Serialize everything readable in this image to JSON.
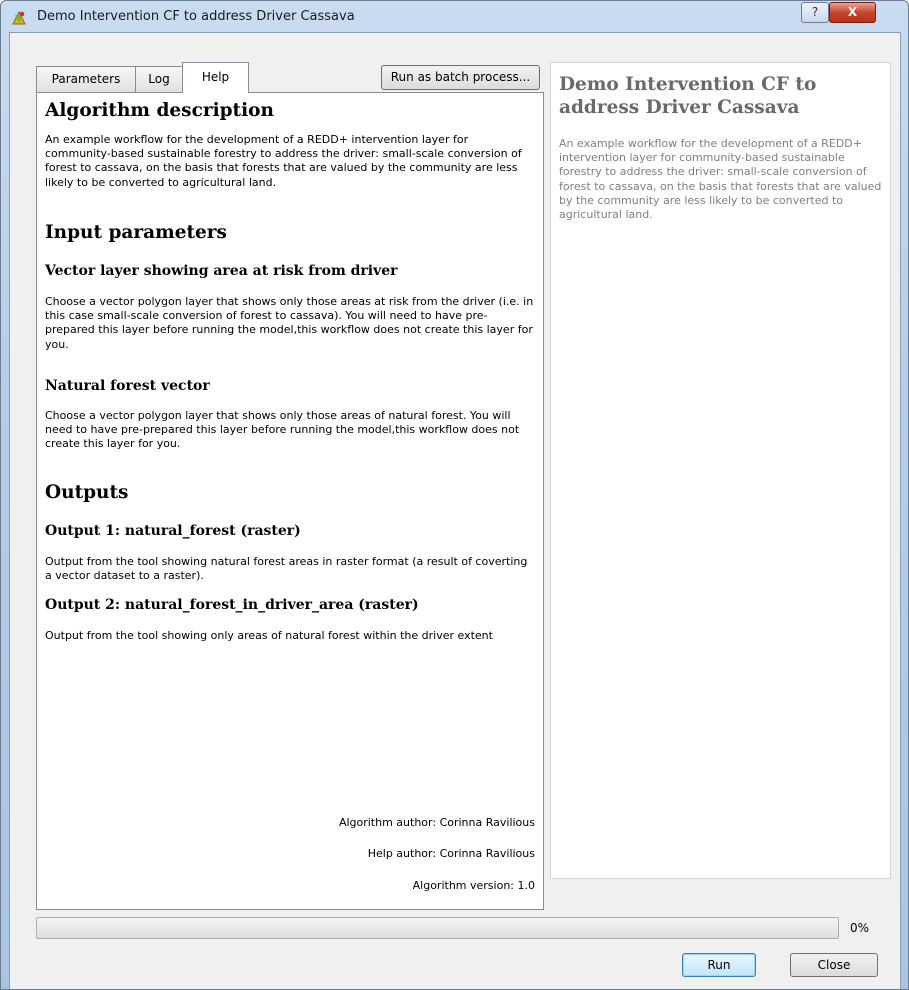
{
  "window": {
    "title": "Demo Intervention CF to address Driver Cassava",
    "help_glyph": "?",
    "close_glyph": "X"
  },
  "tabs": [
    {
      "label": "Parameters",
      "active": false
    },
    {
      "label": "Log",
      "active": false
    },
    {
      "label": "Help",
      "active": true
    }
  ],
  "batch_button": "Run as batch process...",
  "help": {
    "algorithm_heading": "Algorithm description",
    "algorithm_text": "An example workflow for the development of a REDD+ intervention layer for community-based sustainable forestry to address the driver: small-scale conversion of forest to cassava, on the basis that forests that are valued by the community are less likely to be converted to agricultural land.",
    "inputs_heading": "Input parameters",
    "inputs": [
      {
        "name": "Vector layer showing area at risk from driver",
        "text": "Choose a vector polygon layer that shows only those areas at risk from the driver (i.e. in this case small-scale conversion of forest to cassava). You will need to have pre-prepared this layer before running the model,this workflow does not create this layer for you."
      },
      {
        "name": "Natural forest vector",
        "text": "Choose a vector polygon layer that shows only those areas of natural forest. You will need to have pre-prepared this layer before running the model,this workflow does not create this layer for you."
      }
    ],
    "outputs_heading": "Outputs",
    "outputs": [
      {
        "name": "Output 1: natural_forest (raster)",
        "text": "Output from the tool showing natural forest areas in raster format (a result of coverting a vector dataset to a raster)."
      },
      {
        "name": "Output 2: natural_forest_in_driver_area (raster)",
        "text": "Output from the tool showing only areas of natural forest within the driver extent"
      }
    ],
    "algorithm_author": "Algorithm author: Corinna Ravilious",
    "help_author": "Help author: Corinna Ravilious",
    "algorithm_version": "Algorithm version: 1.0"
  },
  "summary": {
    "title": "Demo Intervention CF to address Driver Cassava",
    "description": "An example workflow for the development of a REDD+ intervention layer for community-based sustainable forestry to address the driver: small-scale conversion of forest to cassava, on the basis that forests that are valued by the community are less likely to be converted to agricultural land."
  },
  "progress": {
    "value": 0,
    "label": "0%",
    "fill_color": "#3fbf3f"
  },
  "buttons": {
    "run": "Run",
    "close": "Close"
  },
  "icons": {
    "app": "qgis-processing-icon",
    "help": "question-mark-icon",
    "close": "close-x-icon"
  }
}
